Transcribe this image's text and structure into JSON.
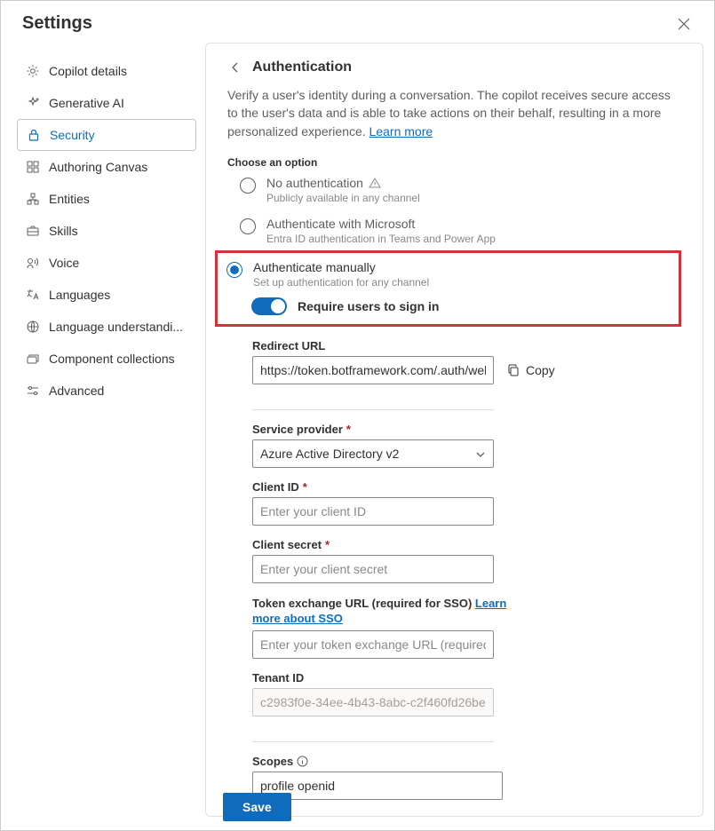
{
  "header": {
    "title": "Settings"
  },
  "sidebar": {
    "items": [
      {
        "label": "Copilot details"
      },
      {
        "label": "Generative AI"
      },
      {
        "label": "Security"
      },
      {
        "label": "Authoring Canvas"
      },
      {
        "label": "Entities"
      },
      {
        "label": "Skills"
      },
      {
        "label": "Voice"
      },
      {
        "label": "Languages"
      },
      {
        "label": "Language understandi..."
      },
      {
        "label": "Component collections"
      },
      {
        "label": "Advanced"
      }
    ]
  },
  "main": {
    "title": "Authentication",
    "description": "Verify a user's identity during a conversation. The copilot receives secure access to the user's data and is able to take actions on their behalf, resulting in a more personalized experience. ",
    "learn_more": "Learn more",
    "choose_label": "Choose an option",
    "options": {
      "none": {
        "title": "No authentication",
        "sub": "Publicly available in any channel"
      },
      "msft": {
        "title": "Authenticate with Microsoft",
        "sub": "Entra ID authentication in Teams and Power App"
      },
      "manual": {
        "title": "Authenticate manually",
        "sub": "Set up authentication for any channel"
      }
    },
    "require_signin": "Require users to sign in",
    "redirect": {
      "label": "Redirect URL",
      "value": "https://token.botframework.com/.auth/web/re",
      "copy": "Copy"
    },
    "provider": {
      "label": "Service provider",
      "value": "Azure Active Directory v2"
    },
    "client_id": {
      "label": "Client ID",
      "placeholder": "Enter your client ID"
    },
    "client_secret": {
      "label": "Client secret",
      "placeholder": "Enter your client secret"
    },
    "sso": {
      "label_a": "Token exchange URL (required for SSO) ",
      "label_link": "Learn more about SSO",
      "placeholder": "Enter your token exchange URL (required for S"
    },
    "tenant": {
      "label": "Tenant ID",
      "value": "c2983f0e-34ee-4b43-8abc-c2f460fd26be"
    },
    "scopes": {
      "label": "Scopes",
      "value": "profile openid"
    }
  },
  "footer": {
    "save": "Save"
  }
}
